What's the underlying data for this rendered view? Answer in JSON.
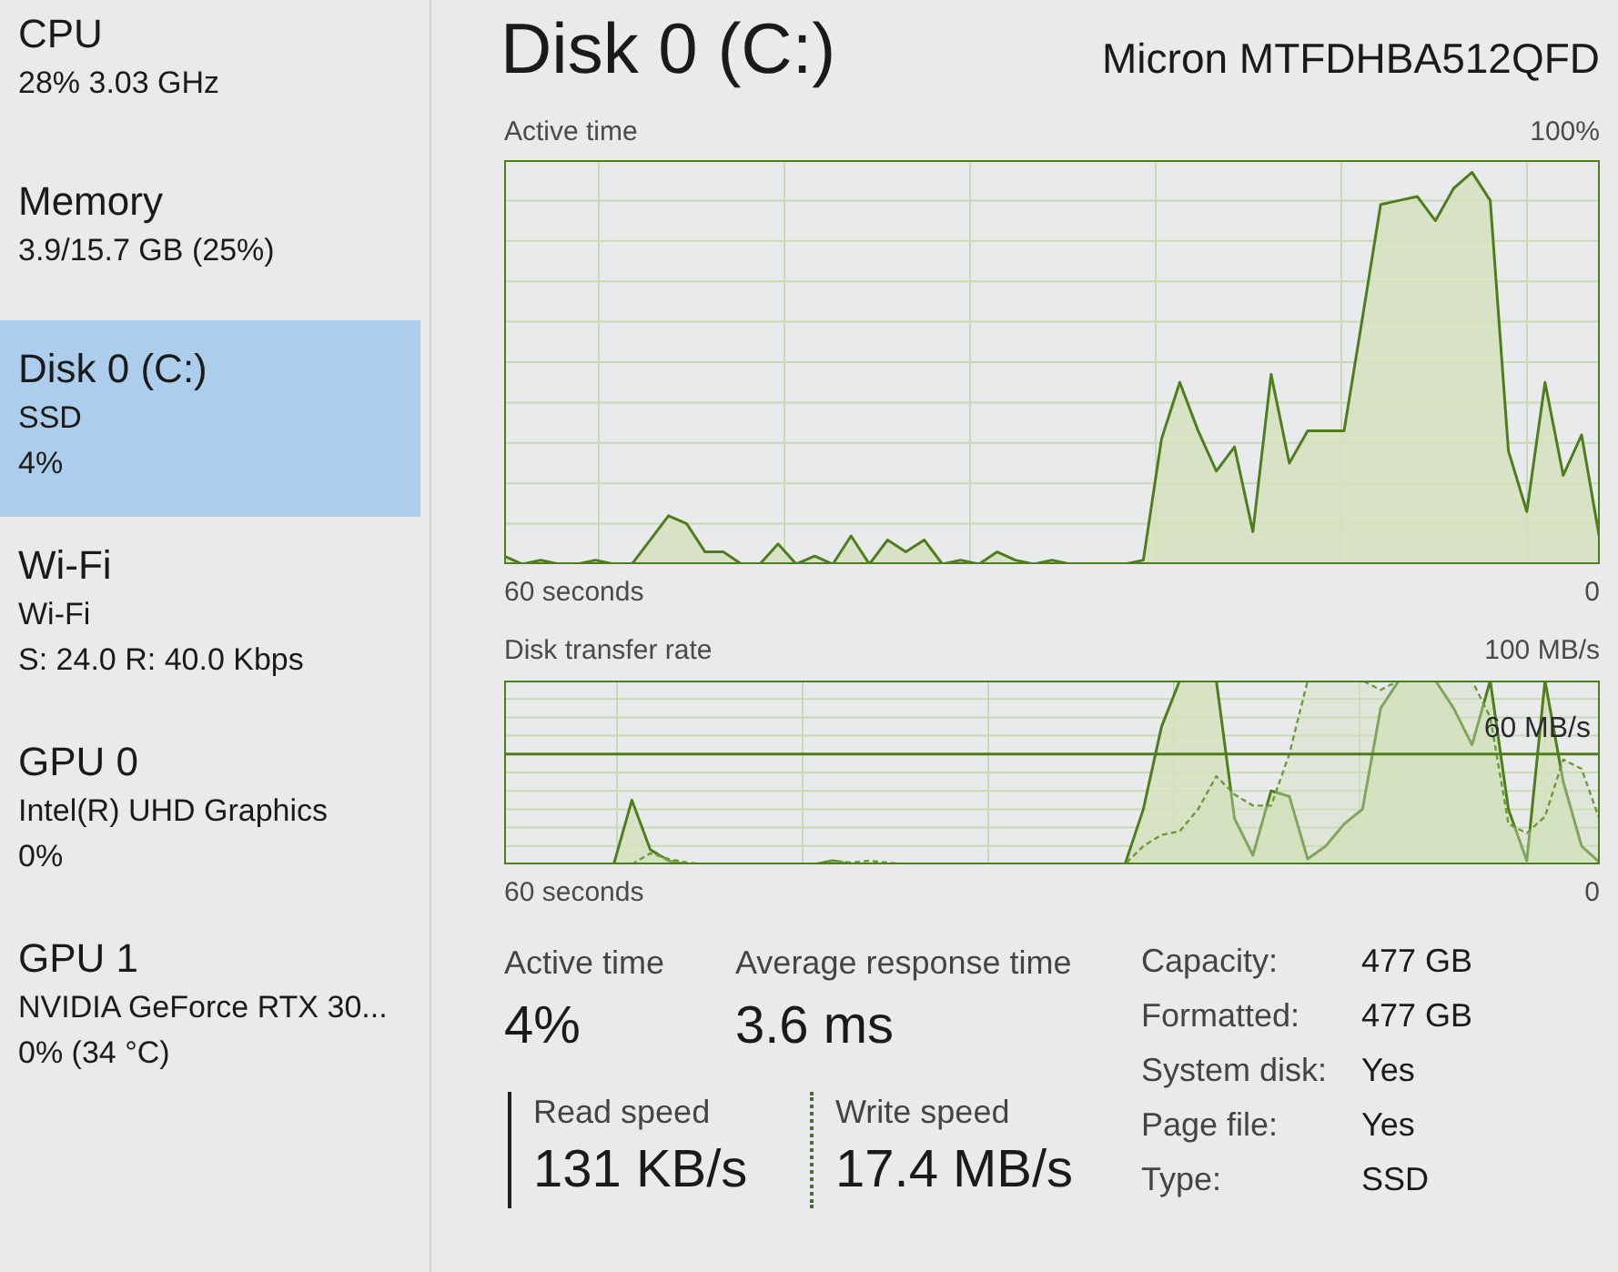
{
  "sidebar": {
    "items": [
      {
        "title": "CPU",
        "lines": [
          "28% 3.03 GHz"
        ],
        "selected": false
      },
      {
        "title": "Memory",
        "lines": [
          "3.9/15.7 GB (25%)"
        ],
        "selected": false
      },
      {
        "title": "Disk 0 (C:)",
        "lines": [
          "SSD",
          "4%"
        ],
        "selected": true
      },
      {
        "title": "Wi-Fi",
        "lines": [
          "Wi-Fi",
          "S: 24.0 R: 40.0 Kbps"
        ],
        "selected": false
      },
      {
        "title": "GPU 0",
        "lines": [
          "Intel(R) UHD Graphics",
          "0%"
        ],
        "selected": false
      },
      {
        "title": "GPU 1",
        "lines": [
          "NVIDIA GeForce RTX 30...",
          "0% (34 °C)"
        ],
        "selected": false
      }
    ]
  },
  "header": {
    "title": "Disk 0 (C:)",
    "model": "Micron MTFDHBA512QFD"
  },
  "graphs": [
    {
      "title": "Active time",
      "max_label": "100%",
      "time_label": "60 seconds",
      "zero_label": "0"
    },
    {
      "title": "Disk transfer rate",
      "max_label": "100 MB/s",
      "marker_label": "60 MB/s",
      "time_label": "60 seconds",
      "zero_label": "0"
    }
  ],
  "stats": [
    {
      "label": "Active time",
      "value": "4%"
    },
    {
      "label": "Average response time",
      "value": "3.6 ms"
    }
  ],
  "speeds": [
    {
      "label": "Read speed",
      "value": "131 KB/s",
      "kind": "solid"
    },
    {
      "label": "Write speed",
      "value": "17.4 MB/s",
      "kind": "dotted"
    }
  ],
  "properties": [
    {
      "label": "Capacity:",
      "value": "477 GB"
    },
    {
      "label": "Formatted:",
      "value": "477 GB"
    },
    {
      "label": "System disk:",
      "value": "Yes"
    },
    {
      "label": "Page file:",
      "value": "Yes"
    },
    {
      "label": "Type:",
      "value": "SSD"
    }
  ]
}
